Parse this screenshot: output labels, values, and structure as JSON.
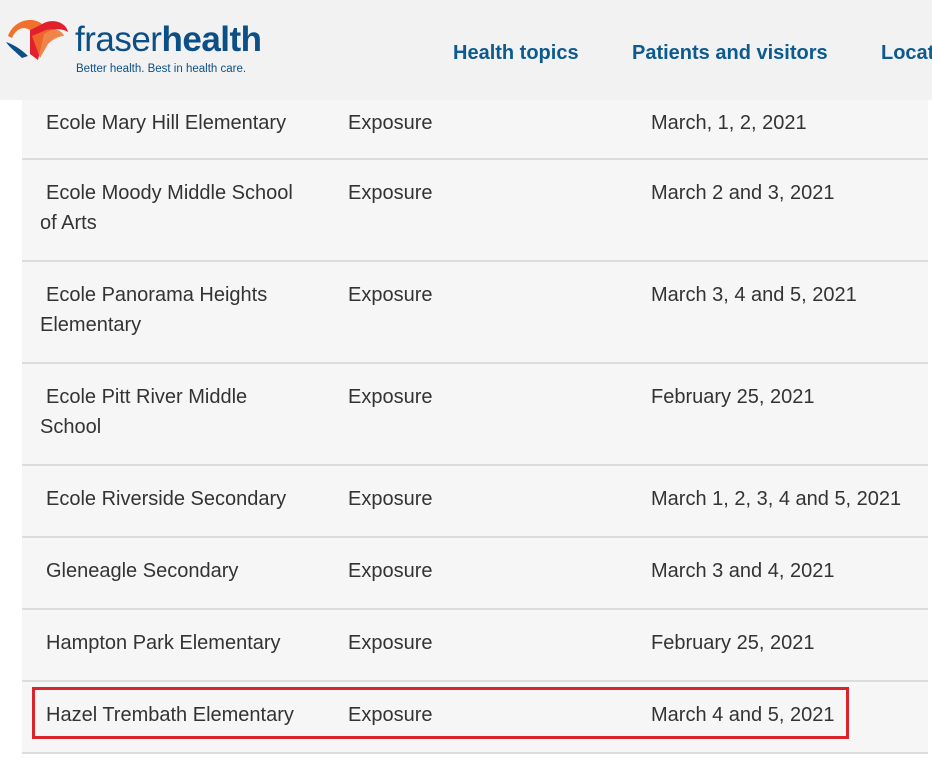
{
  "header": {
    "logo": {
      "word_light": "fraser",
      "word_bold": "health",
      "tagline": "Better health. Best in health care."
    },
    "nav": [
      {
        "label": "Health topics"
      },
      {
        "label": "Patients and visitors"
      },
      {
        "label": "Locat"
      }
    ]
  },
  "colors": {
    "brand_blue": "#0c4f87",
    "logo_orange": "#f0712b",
    "logo_red": "#e2202c",
    "highlight_red": "#d9242b",
    "row_bg": "#f6f6f6"
  },
  "table": {
    "rows": [
      {
        "school": "Ecole Mary Hill Elementary",
        "type": "Exposure",
        "dates": "March, 1, 2, 2021"
      },
      {
        "school": "Ecole Moody Middle School of Arts",
        "type": "Exposure",
        "dates": "March 2 and 3, 2021"
      },
      {
        "school": "Ecole Panorama Heights Elementary",
        "type": "Exposure",
        "dates": "March 3, 4 and 5, 2021"
      },
      {
        "school": "Ecole Pitt River Middle School",
        "type": "Exposure",
        "dates": "February 25, 2021"
      },
      {
        "school": "Ecole Riverside Secondary",
        "type": "Exposure",
        "dates": "March 1, 2, 3, 4 and 5, 2021"
      },
      {
        "school": "Gleneagle Secondary",
        "type": "Exposure",
        "dates": "March 3 and 4, 2021"
      },
      {
        "school": "Hampton Park Elementary",
        "type": "Exposure",
        "dates": "February 25, 2021"
      },
      {
        "school": "Hazel Trembath Elementary",
        "type": "Exposure",
        "dates": "March 4 and 5, 2021",
        "highlighted": true
      }
    ]
  }
}
